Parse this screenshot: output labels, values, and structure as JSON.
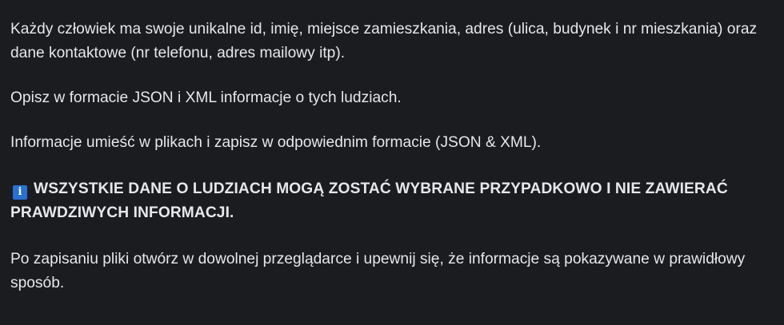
{
  "paragraphs": {
    "p1": "Każdy człowiek ma swoje unikalne id, imię, miejsce zamieszkania, adres (ulica, budynek i nr mieszkania) oraz dane kontaktowe (nr telefonu, adres mailowy itp).",
    "p2": "Opisz w formacie JSON i XML informacje o tych ludziach.",
    "p3": "Informacje umieść w plikach i zapisz w odpowiednim formacie (JSON & XML).",
    "warning": "WSZYSTKIE DANE O LUDZIACH MOGĄ ZOSTAĆ WYBRANE PRZYPADKOWO I NIE ZAWIERAĆ PRAWDZIWYCH INFORMACJI.",
    "p5": "Po zapisaniu pliki otwórz w dowolnej przeglądarce i upewnij się, że informacje są pokazywane w prawidłowy sposób."
  },
  "icons": {
    "info_icon": "info-icon",
    "info_icon_color": "#2a70d3"
  },
  "colors": {
    "background": "#1b1c1f",
    "text": "#e6e7e9"
  }
}
